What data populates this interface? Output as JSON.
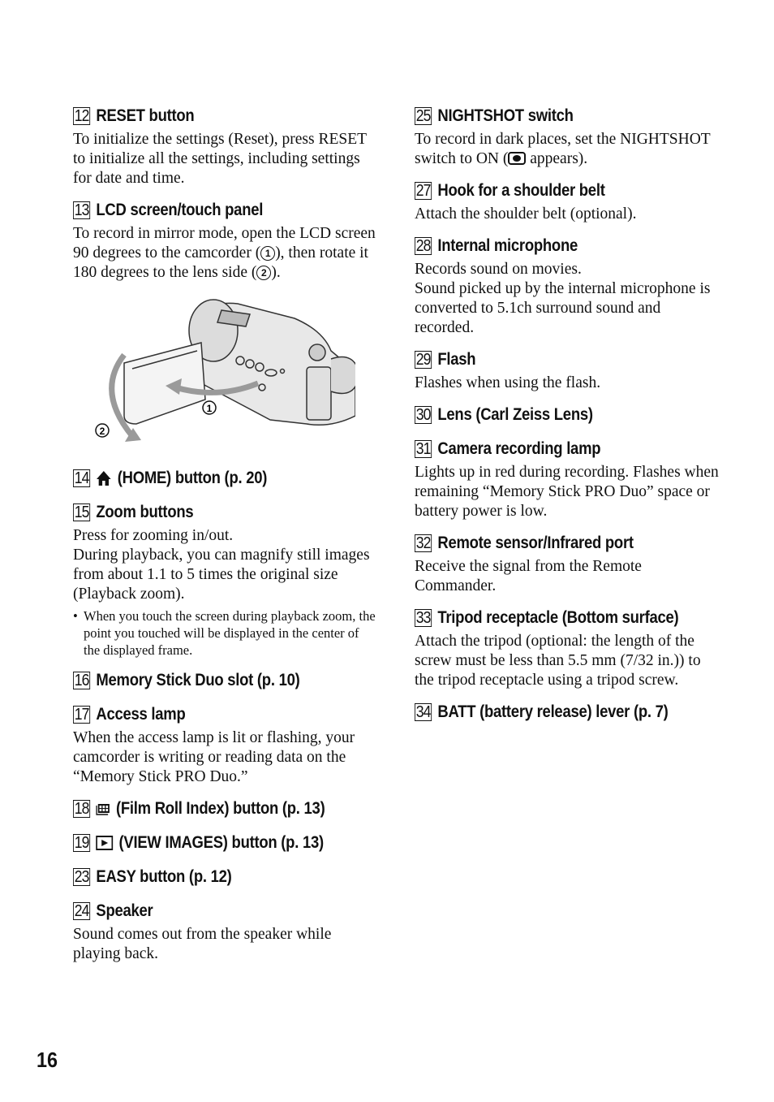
{
  "page_number": "16",
  "left": {
    "i12": {
      "num": "12",
      "title": "RESET button",
      "body": "To initialize the settings (Reset), press RESET to initialize all the settings, including settings for date and time."
    },
    "i13": {
      "num": "13",
      "title": "LCD screen/touch panel",
      "body_a": "To record in mirror mode, open the LCD screen 90 degrees to the camcorder (",
      "c1": "1",
      "body_b": "), then rotate it 180 degrees to the lens side (",
      "c2": "2",
      "body_c": ")."
    },
    "figure": {
      "label1": "1",
      "label2": "2"
    },
    "i14": {
      "num": "14",
      "title": "(HOME) button (p. 20)",
      "icon": "home-icon"
    },
    "i15": {
      "num": "15",
      "title": "Zoom buttons",
      "body1": "Press for zooming in/out.",
      "body2": "During playback, you can magnify still images from about 1.1 to 5 times the original size (Playback zoom).",
      "note": "When you touch the screen during playback zoom, the point you touched will be displayed in the center of the displayed frame."
    },
    "i16": {
      "num": "16",
      "title": "Memory Stick Duo slot (p. 10)"
    },
    "i17": {
      "num": "17",
      "title": "Access lamp",
      "body": "When the access lamp is lit or flashing, your camcorder is writing or reading data on the “Memory Stick PRO Duo.”"
    },
    "i18": {
      "num": "18",
      "title": "(Film Roll Index) button (p. 13)",
      "icon": "film-roll-index-icon"
    },
    "i19": {
      "num": "19",
      "title": "(VIEW IMAGES) button (p. 13)",
      "icon": "view-images-icon"
    },
    "i23": {
      "num": "23",
      "title": "EASY button (p. 12)"
    },
    "i24": {
      "num": "24",
      "title": "Speaker",
      "body": "Sound comes out from the speaker while playing back."
    }
  },
  "right": {
    "i25": {
      "num": "25",
      "title": "NIGHTSHOT switch",
      "body_a": "To record in dark places, set the NIGHTSHOT switch to ON (",
      "body_b": " appears)."
    },
    "i27": {
      "num": "27",
      "title": "Hook for a shoulder belt",
      "body": "Attach the shoulder belt (optional)."
    },
    "i28": {
      "num": "28",
      "title": "Internal microphone",
      "body1": "Records sound on movies.",
      "body2": "Sound picked up by the internal microphone is converted to 5.1ch surround sound and recorded."
    },
    "i29": {
      "num": "29",
      "title": "Flash",
      "body": "Flashes when using the flash."
    },
    "i30": {
      "num": "30",
      "title": "Lens (Carl Zeiss Lens)"
    },
    "i31": {
      "num": "31",
      "title": "Camera recording lamp",
      "body": "Lights up in red during recording. Flashes when remaining “Memory Stick PRO Duo” space or battery power is low."
    },
    "i32": {
      "num": "32",
      "title": "Remote sensor/Infrared port",
      "body": "Receive the signal from the Remote Commander."
    },
    "i33": {
      "num": "33",
      "title": "Tripod receptacle (Bottom surface)",
      "body": "Attach the tripod (optional: the length of the screw must be less than 5.5 mm (7/32 in.)) to the tripod receptacle using a tripod screw."
    },
    "i34": {
      "num": "34",
      "title": "BATT (battery release) lever (p. 7)"
    }
  }
}
